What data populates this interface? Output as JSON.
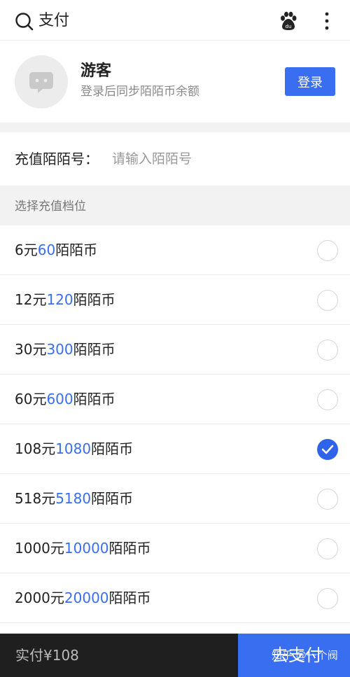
{
  "topbar": {
    "title": "支付",
    "search_icon": "search-icon",
    "paw_icon": "baidu-paw-icon",
    "more_icon": "more-vertical-icon"
  },
  "profile": {
    "name": "游客",
    "subtitle": "登录后同步陌陌币余额",
    "login_label": "登录",
    "avatar_icon": "chat-bubble-icon"
  },
  "account": {
    "label": "充值陌陌号：",
    "placeholder": "请输入陌陌号",
    "value": ""
  },
  "section": {
    "title": "选择充值档位"
  },
  "options": [
    {
      "price": "6元",
      "coins": "60",
      "unit": "陌陌币",
      "selected": false
    },
    {
      "price": "12元",
      "coins": "120",
      "unit": "陌陌币",
      "selected": false
    },
    {
      "price": "30元",
      "coins": "300",
      "unit": "陌陌币",
      "selected": false
    },
    {
      "price": "60元",
      "coins": "600",
      "unit": "陌陌币",
      "selected": false
    },
    {
      "price": "108元",
      "coins": "1080",
      "unit": "陌陌币",
      "selected": true
    },
    {
      "price": "518元",
      "coins": "5180",
      "unit": "陌陌币",
      "selected": false
    },
    {
      "price": "1000元",
      "coins": "10000",
      "unit": "陌陌币",
      "selected": false
    },
    {
      "price": "2000元",
      "coins": "20000",
      "unit": "陌陌币",
      "selected": false
    }
  ],
  "bottom": {
    "total": "实付¥108",
    "pay_label": "去支付",
    "watermark": "知乎 @一个阀"
  },
  "colors": {
    "accent": "#3a6ef0",
    "bottom_dark": "#1f1f1f",
    "section_bg": "#f2f2f2"
  }
}
